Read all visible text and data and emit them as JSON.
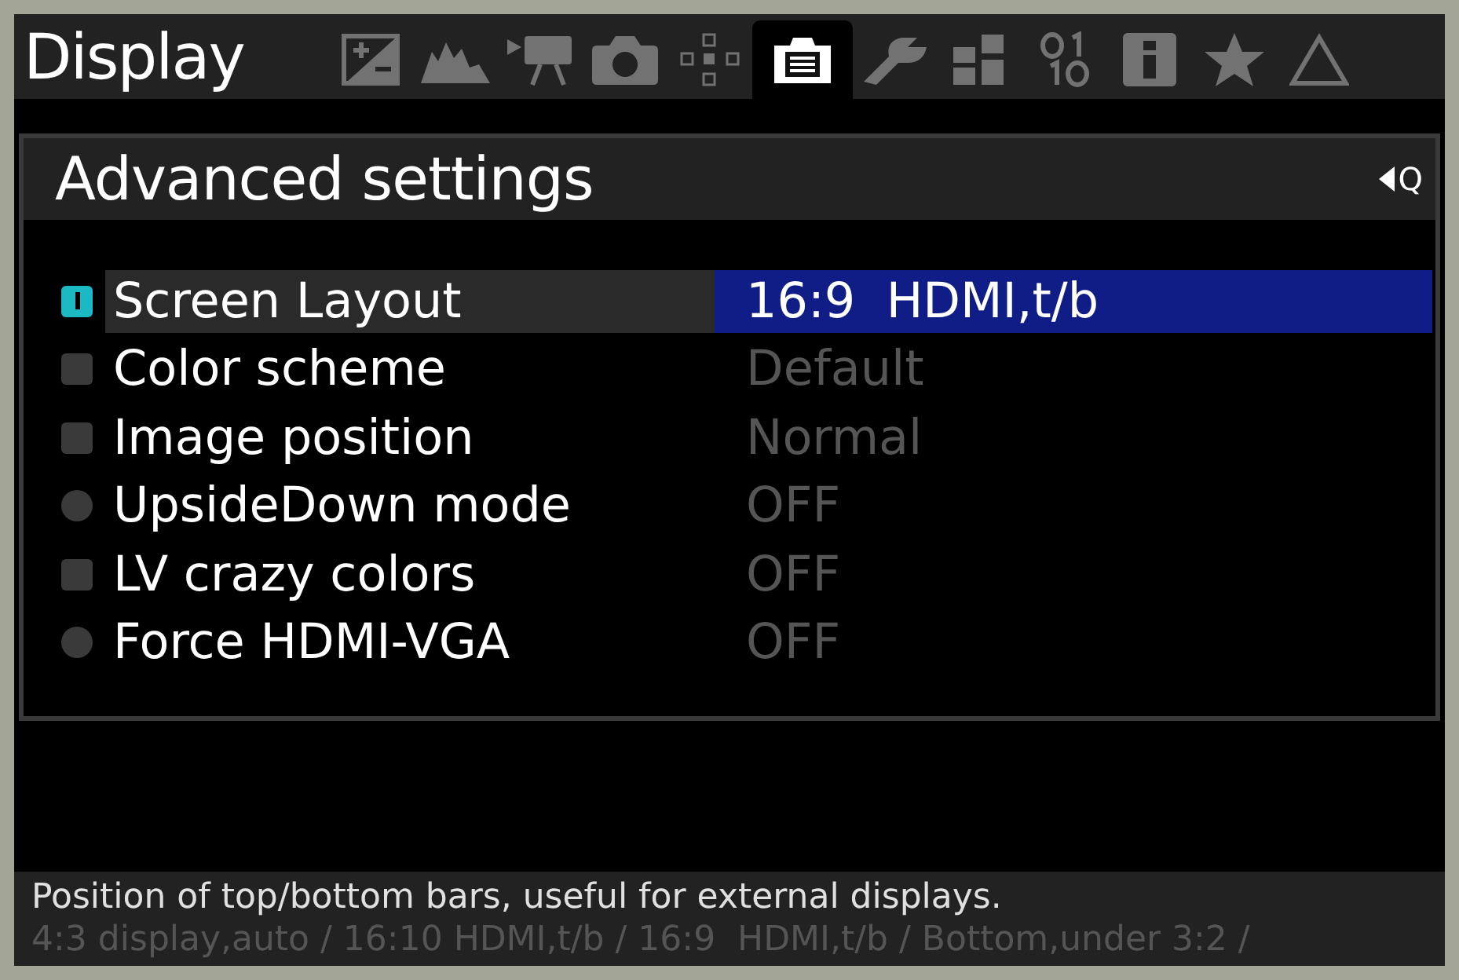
{
  "menu_title": "Display",
  "tabs": [
    {
      "kind": "exposure",
      "selected": false
    },
    {
      "kind": "histogram",
      "selected": false
    },
    {
      "kind": "movie",
      "selected": false
    },
    {
      "kind": "camera",
      "selected": false
    },
    {
      "kind": "focus",
      "selected": false
    },
    {
      "kind": "display",
      "selected": true
    },
    {
      "kind": "wrench",
      "selected": false
    },
    {
      "kind": "modules",
      "selected": false
    },
    {
      "kind": "debug",
      "selected": false
    },
    {
      "kind": "info",
      "selected": false
    },
    {
      "kind": "star",
      "selected": false
    },
    {
      "kind": "triangle",
      "selected": false
    }
  ],
  "submenu": {
    "title": "Advanced settings",
    "back_hint": "Q"
  },
  "items": [
    {
      "kind": "square",
      "label": "Screen Layout",
      "value": "16:9  HDMI,t/b",
      "selected": true
    },
    {
      "kind": "square",
      "label": "Color scheme",
      "value": "Default",
      "selected": false
    },
    {
      "kind": "square",
      "label": "Image position",
      "value": "Normal",
      "selected": false
    },
    {
      "kind": "round",
      "label": "UpsideDown mode",
      "value": "OFF",
      "selected": false
    },
    {
      "kind": "square",
      "label": "LV crazy colors",
      "value": "OFF",
      "selected": false
    },
    {
      "kind": "round",
      "label": "Force HDMI-VGA",
      "value": "OFF",
      "selected": false
    }
  ],
  "help": "Position of top/bottom bars, useful for external displays.",
  "choices": "4:3 display,auto / 16:10 HDMI,t/b / 16:9  HDMI,t/b / Bottom,under 3:2 /"
}
